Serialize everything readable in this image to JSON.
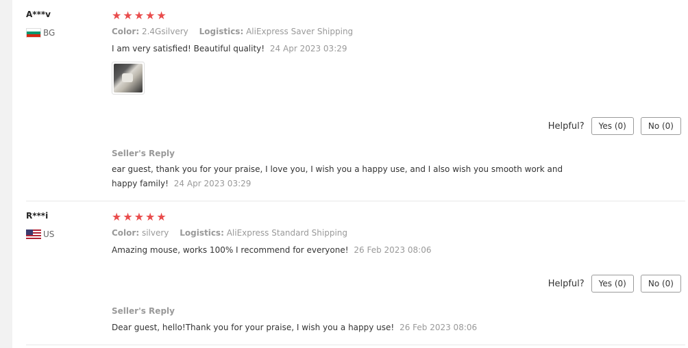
{
  "reviews": [
    {
      "user": "A***v",
      "country": "BG",
      "stars": 5,
      "color_label": "Color:",
      "color_value": "2.4Gsilvery",
      "logistics_label": "Logistics:",
      "logistics_value": "AliExpress Saver Shipping",
      "text": "I am very satisfied! Beautiful quality!",
      "date": "24 Apr 2023 03:29",
      "helpful_label": "Helpful?",
      "yes_label": "Yes (0)",
      "no_label": "No (0)",
      "seller_title": "Seller's Reply",
      "seller_text": "ear guest, thank you for your praise, I love you, I wish you a happy use, and I also wish you smooth work and happy family!",
      "seller_date": "24 Apr 2023 03:29"
    },
    {
      "user": "R***i",
      "country": "US",
      "stars": 5,
      "color_label": "Color:",
      "color_value": "silvery",
      "logistics_label": "Logistics:",
      "logistics_value": "AliExpress Standard Shipping",
      "text": "Amazing mouse, works 100% I recommend for everyone!",
      "date": "26 Feb 2023 08:06",
      "helpful_label": "Helpful?",
      "yes_label": "Yes (0)",
      "no_label": "No (0)",
      "seller_title": "Seller's Reply",
      "seller_text": "Dear guest, hello!Thank you for your praise, I wish you a happy use!",
      "seller_date": "26 Feb 2023 08:06"
    }
  ],
  "icons": {
    "star": "star-icon",
    "flag_bg": "flag-bg-icon",
    "flag_us": "flag-us-icon"
  },
  "colors": {
    "star": "#e94c4c",
    "meta": "#999999"
  }
}
